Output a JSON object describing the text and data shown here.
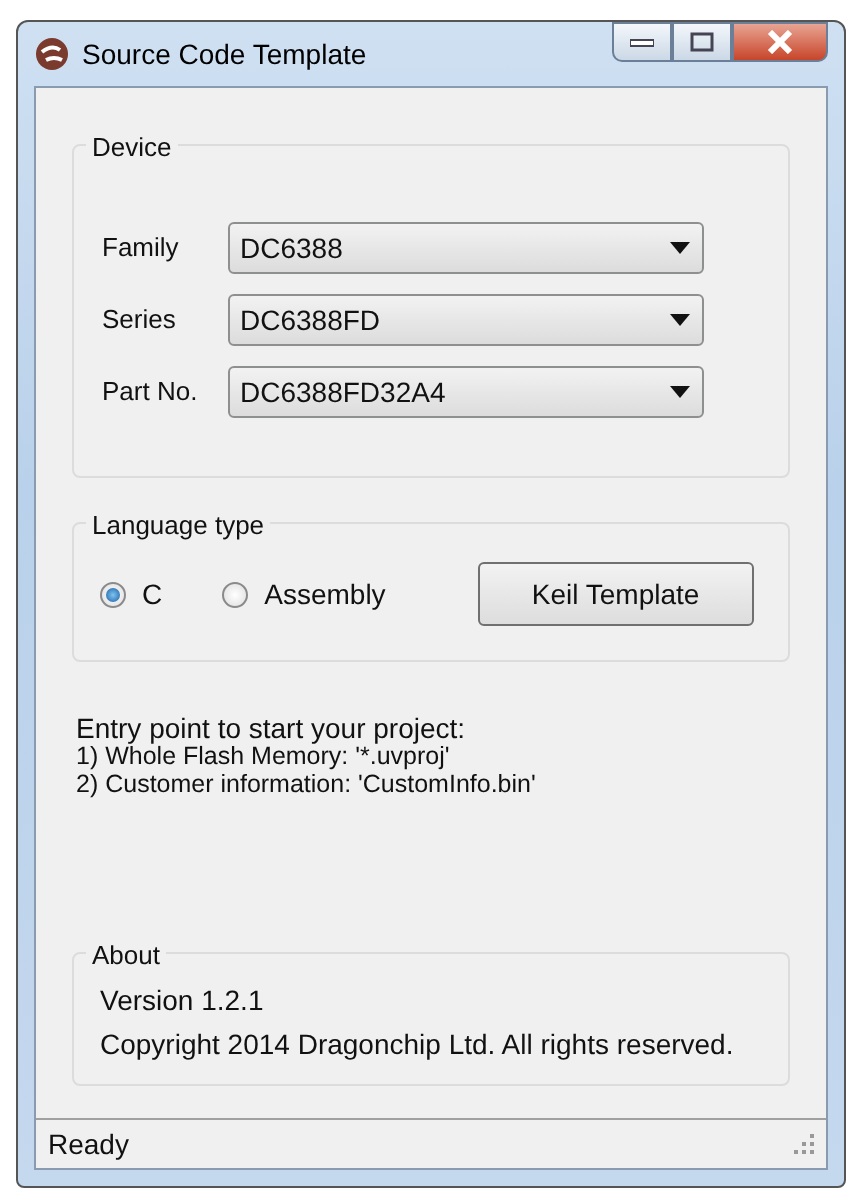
{
  "window": {
    "title": "Source Code Template"
  },
  "device": {
    "title": "Device",
    "fields": [
      {
        "label": "Family",
        "value": "DC6388"
      },
      {
        "label": "Series",
        "value": "DC6388FD"
      },
      {
        "label": "Part No.",
        "value": "DC6388FD32A4"
      }
    ]
  },
  "language": {
    "title": "Language type",
    "options": [
      {
        "label": "C",
        "selected": true
      },
      {
        "label": "Assembly",
        "selected": false
      }
    ],
    "button": "Keil Template"
  },
  "entry_text": [
    "Entry point to start your project:",
    "1) Whole Flash Memory: '*.uvproj'",
    "2) Customer information: 'CustomInfo.bin'"
  ],
  "about": {
    "title": "About",
    "lines": [
      "Version 1.2.1",
      "Copyright 2014 Dragonchip Ltd. All rights reserved."
    ]
  },
  "status_bar": "Ready"
}
